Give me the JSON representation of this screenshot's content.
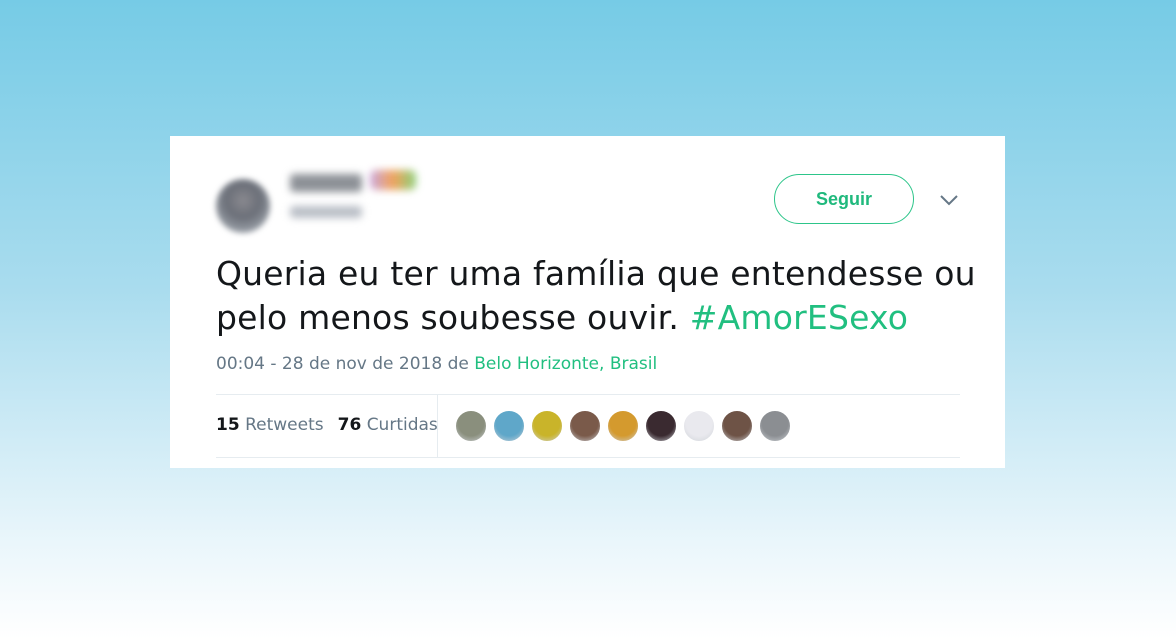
{
  "tweet": {
    "follow_label": "Seguir",
    "text_main": "Queria eu ter uma família que entendesse ou pelo menos soubesse ouvir. ",
    "hashtag": "#AmorESexo",
    "timestamp": "00:04 - 28 de nov de 2018",
    "location_prefix": " de ",
    "location": "Belo Horizonte, Brasil",
    "retweets_count": "15",
    "retweets_label": "Retweets",
    "likes_count": "76",
    "likes_label": "Curtidas"
  },
  "colors": {
    "accent": "#21bf80",
    "text": "#14171a",
    "muted": "#657786"
  },
  "likers": [
    {
      "name": "liker-avatar-1",
      "color": "#8a8f7d"
    },
    {
      "name": "liker-avatar-2",
      "color": "#5fa7c9"
    },
    {
      "name": "liker-avatar-3",
      "color": "#c9b42a"
    },
    {
      "name": "liker-avatar-4",
      "color": "#7a5a4a"
    },
    {
      "name": "liker-avatar-5",
      "color": "#d49a2e"
    },
    {
      "name": "liker-avatar-6",
      "color": "#3a2a30"
    },
    {
      "name": "liker-avatar-7",
      "color": "#e9e9ee"
    },
    {
      "name": "liker-avatar-8",
      "color": "#6e5346"
    },
    {
      "name": "liker-avatar-9",
      "color": "#8b8e92"
    }
  ]
}
